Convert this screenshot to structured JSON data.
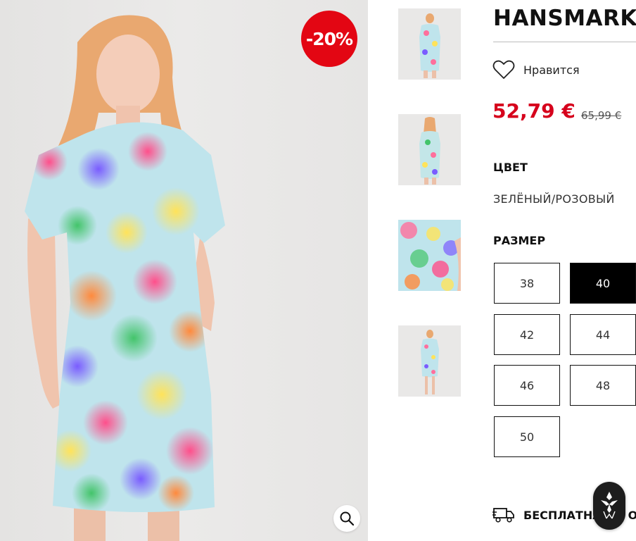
{
  "product": {
    "title": "HANSMARK",
    "discount_badge": "-20%",
    "wishlist_label": "Нравится",
    "price_current": "52,79 €",
    "price_old": "65,99 €",
    "color_section_label": "ЦВЕТ",
    "color_value": "ЗЕЛЁНЫЙ/РОЗОВЫЙ",
    "size_section_label": "РАЗМЕР",
    "sizes": [
      {
        "label": "38",
        "selected": false
      },
      {
        "label": "40",
        "selected": true
      },
      {
        "label": "42",
        "selected": false
      },
      {
        "label": "44",
        "selected": false
      },
      {
        "label": "46",
        "selected": false
      },
      {
        "label": "48",
        "selected": false
      },
      {
        "label": "50",
        "selected": false
      }
    ],
    "delivery_label": "БЕСПЛАТНА",
    "delivery_label_suffix": "ОС"
  },
  "gallery": {
    "thumbnails": [
      "front-view",
      "back-view",
      "fabric-closeup",
      "full-length-view"
    ],
    "zoom_icon": "magnifier-icon"
  },
  "icons": {
    "wishlist": "heart-outline-icon",
    "delivery": "delivery-truck-icon",
    "chat": "chat-badge-icon"
  },
  "colors": {
    "accent_red": "#e30613",
    "price_red": "#d6001c",
    "selected_size_bg": "#000000",
    "chat_bg": "#1d1d1d"
  }
}
